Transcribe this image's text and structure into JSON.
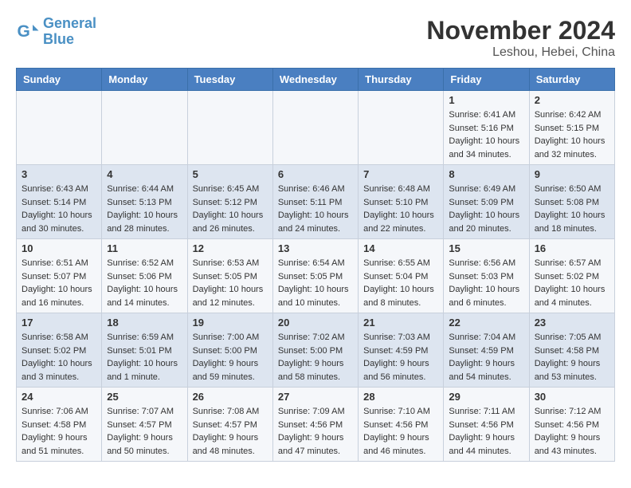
{
  "header": {
    "logo_line1": "General",
    "logo_line2": "Blue",
    "month": "November 2024",
    "location": "Leshou, Hebei, China"
  },
  "weekdays": [
    "Sunday",
    "Monday",
    "Tuesday",
    "Wednesday",
    "Thursday",
    "Friday",
    "Saturday"
  ],
  "weeks": [
    [
      {
        "day": "",
        "info": ""
      },
      {
        "day": "",
        "info": ""
      },
      {
        "day": "",
        "info": ""
      },
      {
        "day": "",
        "info": ""
      },
      {
        "day": "",
        "info": ""
      },
      {
        "day": "1",
        "info": "Sunrise: 6:41 AM\nSunset: 5:16 PM\nDaylight: 10 hours\nand 34 minutes."
      },
      {
        "day": "2",
        "info": "Sunrise: 6:42 AM\nSunset: 5:15 PM\nDaylight: 10 hours\nand 32 minutes."
      }
    ],
    [
      {
        "day": "3",
        "info": "Sunrise: 6:43 AM\nSunset: 5:14 PM\nDaylight: 10 hours\nand 30 minutes."
      },
      {
        "day": "4",
        "info": "Sunrise: 6:44 AM\nSunset: 5:13 PM\nDaylight: 10 hours\nand 28 minutes."
      },
      {
        "day": "5",
        "info": "Sunrise: 6:45 AM\nSunset: 5:12 PM\nDaylight: 10 hours\nand 26 minutes."
      },
      {
        "day": "6",
        "info": "Sunrise: 6:46 AM\nSunset: 5:11 PM\nDaylight: 10 hours\nand 24 minutes."
      },
      {
        "day": "7",
        "info": "Sunrise: 6:48 AM\nSunset: 5:10 PM\nDaylight: 10 hours\nand 22 minutes."
      },
      {
        "day": "8",
        "info": "Sunrise: 6:49 AM\nSunset: 5:09 PM\nDaylight: 10 hours\nand 20 minutes."
      },
      {
        "day": "9",
        "info": "Sunrise: 6:50 AM\nSunset: 5:08 PM\nDaylight: 10 hours\nand 18 minutes."
      }
    ],
    [
      {
        "day": "10",
        "info": "Sunrise: 6:51 AM\nSunset: 5:07 PM\nDaylight: 10 hours\nand 16 minutes."
      },
      {
        "day": "11",
        "info": "Sunrise: 6:52 AM\nSunset: 5:06 PM\nDaylight: 10 hours\nand 14 minutes."
      },
      {
        "day": "12",
        "info": "Sunrise: 6:53 AM\nSunset: 5:05 PM\nDaylight: 10 hours\nand 12 minutes."
      },
      {
        "day": "13",
        "info": "Sunrise: 6:54 AM\nSunset: 5:05 PM\nDaylight: 10 hours\nand 10 minutes."
      },
      {
        "day": "14",
        "info": "Sunrise: 6:55 AM\nSunset: 5:04 PM\nDaylight: 10 hours\nand 8 minutes."
      },
      {
        "day": "15",
        "info": "Sunrise: 6:56 AM\nSunset: 5:03 PM\nDaylight: 10 hours\nand 6 minutes."
      },
      {
        "day": "16",
        "info": "Sunrise: 6:57 AM\nSunset: 5:02 PM\nDaylight: 10 hours\nand 4 minutes."
      }
    ],
    [
      {
        "day": "17",
        "info": "Sunrise: 6:58 AM\nSunset: 5:02 PM\nDaylight: 10 hours\nand 3 minutes."
      },
      {
        "day": "18",
        "info": "Sunrise: 6:59 AM\nSunset: 5:01 PM\nDaylight: 10 hours\nand 1 minute."
      },
      {
        "day": "19",
        "info": "Sunrise: 7:00 AM\nSunset: 5:00 PM\nDaylight: 9 hours\nand 59 minutes."
      },
      {
        "day": "20",
        "info": "Sunrise: 7:02 AM\nSunset: 5:00 PM\nDaylight: 9 hours\nand 58 minutes."
      },
      {
        "day": "21",
        "info": "Sunrise: 7:03 AM\nSunset: 4:59 PM\nDaylight: 9 hours\nand 56 minutes."
      },
      {
        "day": "22",
        "info": "Sunrise: 7:04 AM\nSunset: 4:59 PM\nDaylight: 9 hours\nand 54 minutes."
      },
      {
        "day": "23",
        "info": "Sunrise: 7:05 AM\nSunset: 4:58 PM\nDaylight: 9 hours\nand 53 minutes."
      }
    ],
    [
      {
        "day": "24",
        "info": "Sunrise: 7:06 AM\nSunset: 4:58 PM\nDaylight: 9 hours\nand 51 minutes."
      },
      {
        "day": "25",
        "info": "Sunrise: 7:07 AM\nSunset: 4:57 PM\nDaylight: 9 hours\nand 50 minutes."
      },
      {
        "day": "26",
        "info": "Sunrise: 7:08 AM\nSunset: 4:57 PM\nDaylight: 9 hours\nand 48 minutes."
      },
      {
        "day": "27",
        "info": "Sunrise: 7:09 AM\nSunset: 4:56 PM\nDaylight: 9 hours\nand 47 minutes."
      },
      {
        "day": "28",
        "info": "Sunrise: 7:10 AM\nSunset: 4:56 PM\nDaylight: 9 hours\nand 46 minutes."
      },
      {
        "day": "29",
        "info": "Sunrise: 7:11 AM\nSunset: 4:56 PM\nDaylight: 9 hours\nand 44 minutes."
      },
      {
        "day": "30",
        "info": "Sunrise: 7:12 AM\nSunset: 4:56 PM\nDaylight: 9 hours\nand 43 minutes."
      }
    ]
  ]
}
